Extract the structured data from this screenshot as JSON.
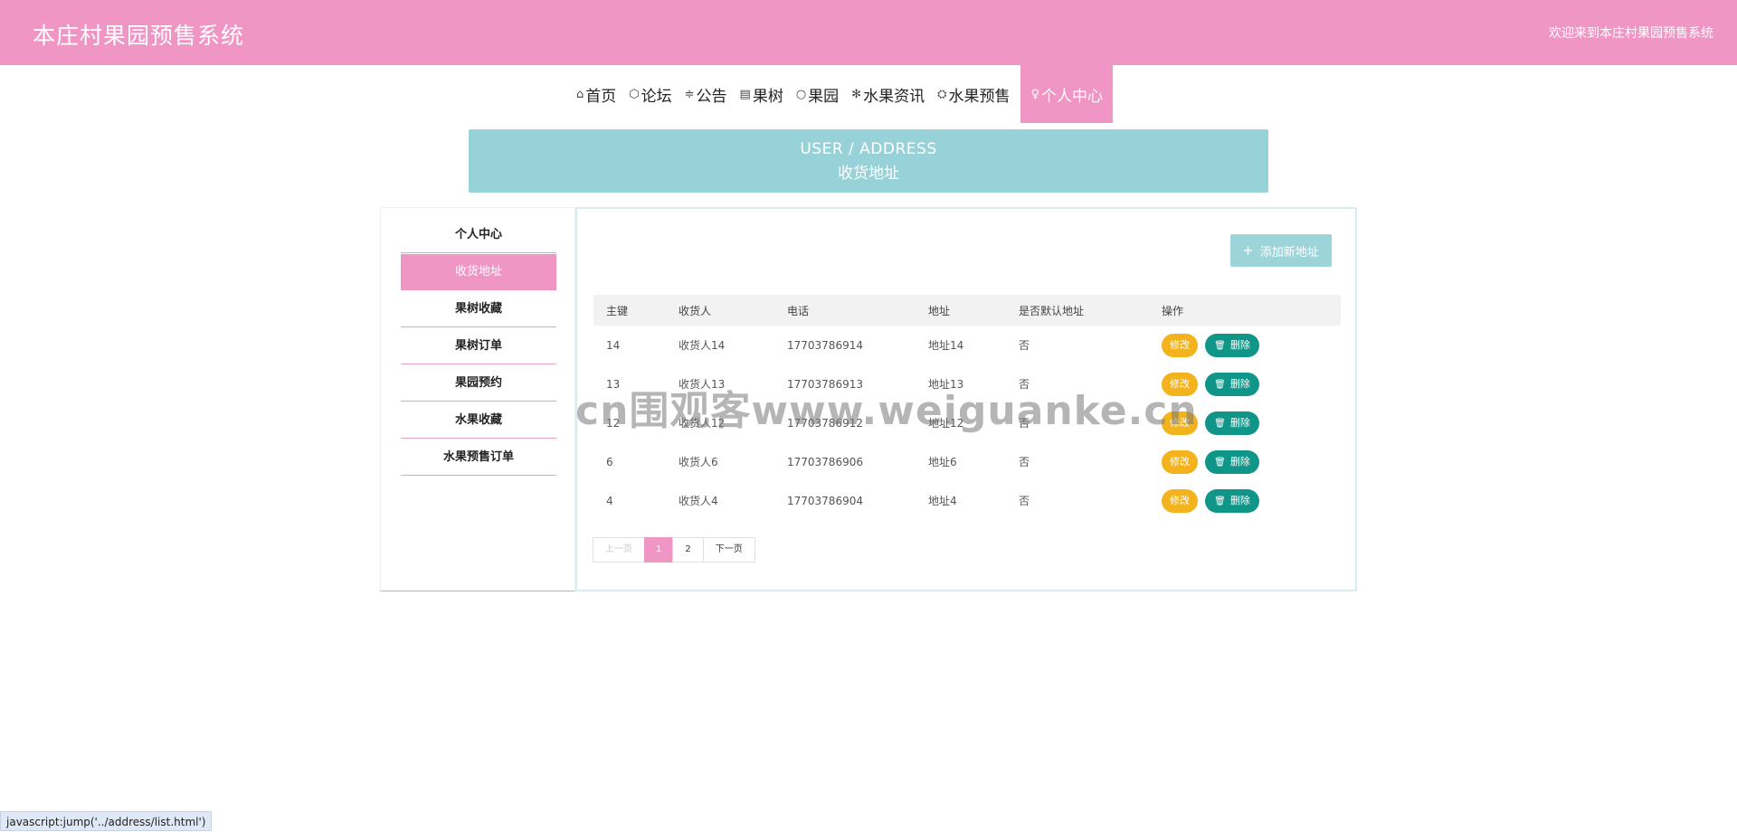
{
  "header": {
    "title": "本庄村果园预售系统",
    "welcome": "欢迎来到本庄村果园预售系统"
  },
  "nav": {
    "items": [
      {
        "label": "首页",
        "icon": "⌂"
      },
      {
        "label": "论坛",
        "icon": "⬡"
      },
      {
        "label": "公告",
        "icon": "≑"
      },
      {
        "label": "果树",
        "icon": "▤"
      },
      {
        "label": "果园",
        "icon": "○"
      },
      {
        "label": "水果资讯",
        "icon": "✻"
      },
      {
        "label": "水果预售",
        "icon": "⛭"
      },
      {
        "label": "个人中心",
        "icon": "♀"
      }
    ],
    "active_index": 7
  },
  "banner": {
    "en": "USER / ADDRESS",
    "cn": "收货地址"
  },
  "sidebar": {
    "items": [
      {
        "label": "个人中心"
      },
      {
        "label": "收货地址"
      },
      {
        "label": "果树收藏"
      },
      {
        "label": "果树订单"
      },
      {
        "label": "果园预约"
      },
      {
        "label": "水果收藏"
      },
      {
        "label": "水果预售订单"
      }
    ],
    "active_index": 1
  },
  "toolbar": {
    "add_label": "添加新地址"
  },
  "table": {
    "headers": [
      "主键",
      "收货人",
      "电话",
      "地址",
      "是否默认地址",
      "操作"
    ],
    "edit_label": "修改",
    "delete_label": "删除",
    "rows": [
      {
        "id": "14",
        "name": "收货人14",
        "phone": "17703786914",
        "address": "地址14",
        "default": "否"
      },
      {
        "id": "13",
        "name": "收货人13",
        "phone": "17703786913",
        "address": "地址13",
        "default": "否"
      },
      {
        "id": "12",
        "name": "收货人12",
        "phone": "17703786912",
        "address": "地址12",
        "default": "否"
      },
      {
        "id": "6",
        "name": "收货人6",
        "phone": "17703786906",
        "address": "地址6",
        "default": "否"
      },
      {
        "id": "4",
        "name": "收货人4",
        "phone": "17703786904",
        "address": "地址4",
        "default": "否"
      }
    ]
  },
  "pager": {
    "prev": "上一页",
    "pages": [
      "1",
      "2"
    ],
    "current": "1",
    "next": "下一页"
  },
  "watermark": "cn围观客www.weiguanke.cn",
  "statusbar": "javascript:jump('../address/list.html')",
  "colors": {
    "brand_pink": "#f096c4",
    "banner_teal": "#98d2d9",
    "edit_yellow": "#f3b31c",
    "delete_teal": "#0f9688"
  }
}
